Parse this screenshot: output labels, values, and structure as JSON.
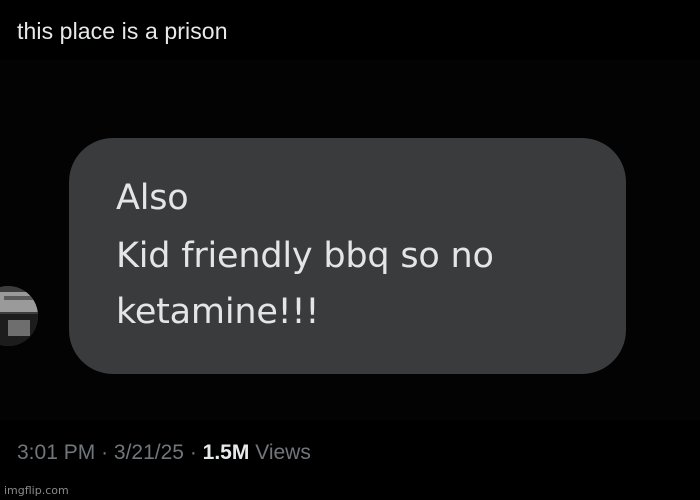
{
  "tweet": {
    "text": "this place is a prison"
  },
  "message_bubble": {
    "lines": [
      "Also",
      "Kid friendly bbq so no",
      "ketamine!!!"
    ]
  },
  "meta": {
    "time": "3:01 PM",
    "separator": "·",
    "date": "3/21/25",
    "views_count": "1.5M",
    "views_label": "Views"
  },
  "watermark": {
    "text": "imgflip.com"
  },
  "colors": {
    "background": "#000000",
    "bubble": "#3a3b3d",
    "text_primary": "#e7e9ea",
    "text_secondary": "#71767b"
  }
}
